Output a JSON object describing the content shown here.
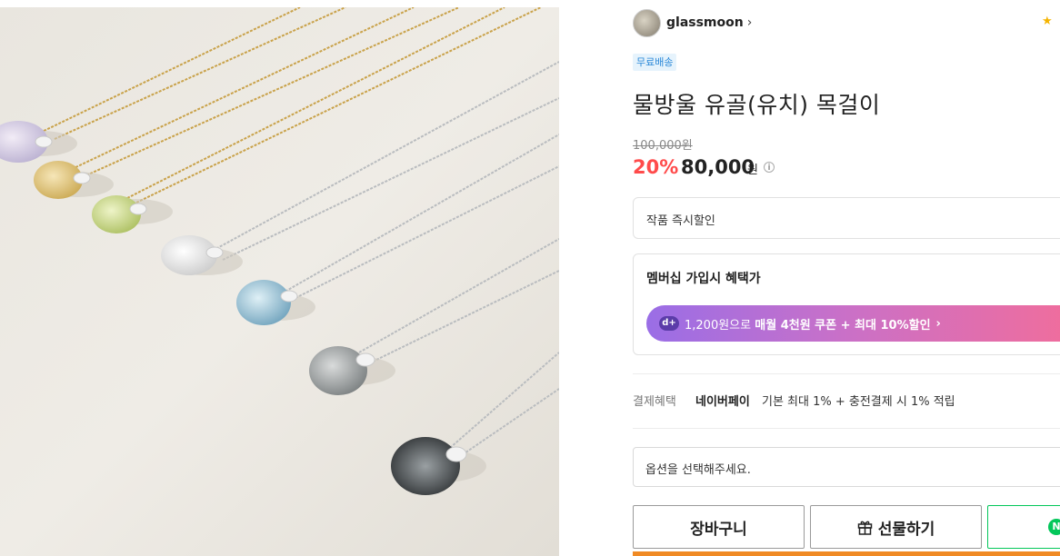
{
  "photo": {
    "alt_subject": "necklace-photo"
  },
  "seller": {
    "name": "glassmoon",
    "chevron": "›"
  },
  "rating": {
    "star": "★"
  },
  "badge": {
    "label": "무료배송"
  },
  "product": {
    "title": "물방울 유골(유치) 목걸이"
  },
  "price": {
    "original": "100,000원",
    "discount_rate": "20%",
    "sale": "80,000",
    "currency": "원",
    "info_icon": "i"
  },
  "discount_box": {
    "label": "작품 즉시할인"
  },
  "membership": {
    "title": "멤버십 가입시 혜택가",
    "icon": "d+",
    "banner_prefix": "1,200원으로",
    "banner_strong1": "매월 4천원 쿠폰 + 최대 10%할인",
    "chevron": "›"
  },
  "payment": {
    "label": "결제혜택",
    "brand": "네이버페이",
    "text": "기본 최대 1% + 충전결제 시 1% 적립"
  },
  "option": {
    "placeholder": "옵션을 선택해주세요."
  },
  "buttons": {
    "cart": "장바구니",
    "gift": "선물하기",
    "npay_icon": "N"
  },
  "colors": {
    "accent_red": "#ff4b4b",
    "npay_green": "#03c75a",
    "badge_blue": "#2a88d8",
    "bottom_bar": "#f08a24"
  }
}
